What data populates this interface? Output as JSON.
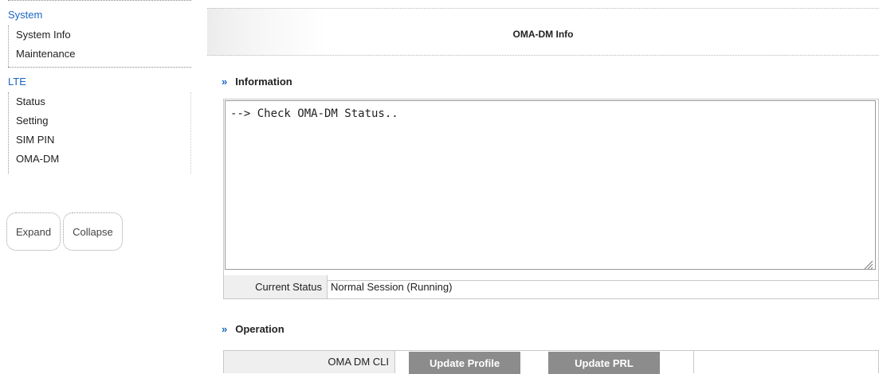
{
  "sidebar": {
    "groups": [
      {
        "title": "System",
        "items": [
          "System Info",
          "Maintenance"
        ]
      },
      {
        "title": "LTE",
        "items": [
          "Status",
          "Setting",
          "SIM PIN",
          "OMA-DM"
        ]
      }
    ],
    "expand_label": "Expand",
    "collapse_label": "Collapse"
  },
  "main": {
    "title": "OMA-DM Info",
    "information": {
      "heading": "Information",
      "log_text": "--> Check OMA-DM Status..",
      "status_label": "Current Status",
      "status_value": "Normal Session (Running)"
    },
    "operation": {
      "heading": "Operation",
      "row_label": "OMA DM CLI",
      "update_profile_label": "Update Profile",
      "update_prl_label": "Update PRL"
    }
  },
  "colors": {
    "link_blue": "#1a66c4",
    "button_gray": "#8c8c8c",
    "label_bg": "#efefef"
  },
  "icons": {
    "section_marker": "double-chevron-right-icon",
    "resize": "resize-grip-icon"
  }
}
